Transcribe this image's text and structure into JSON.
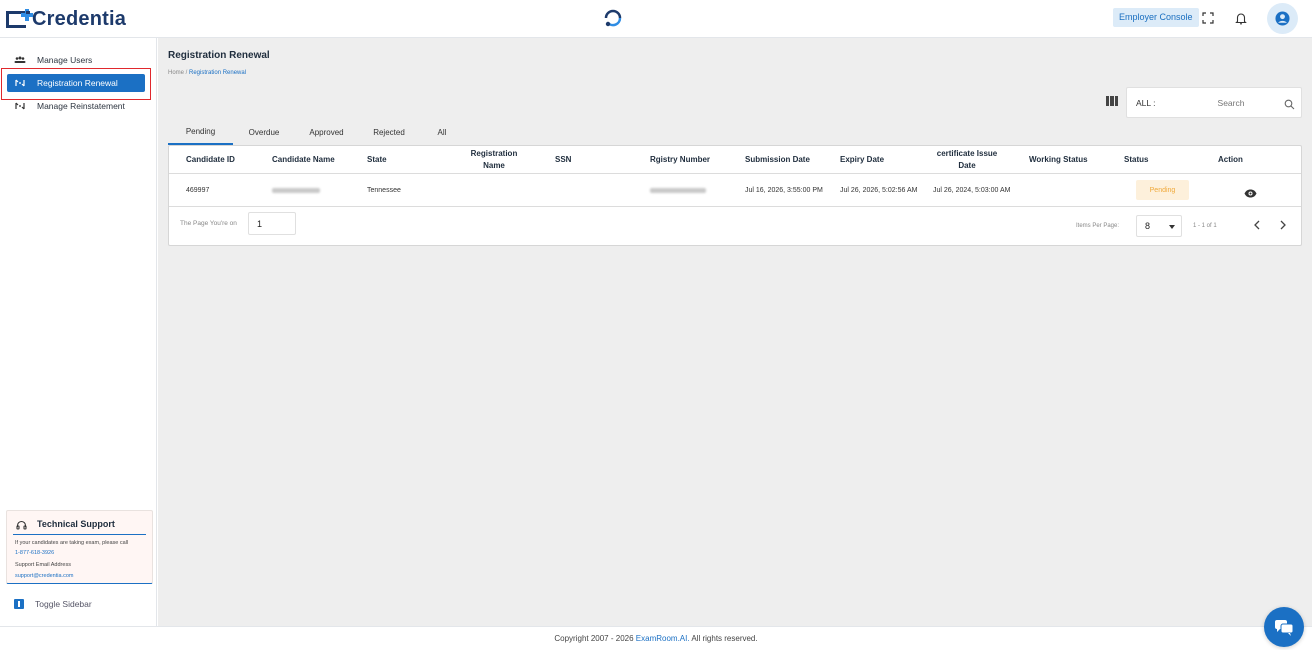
{
  "header": {
    "logo_text": "Credentia",
    "console_label": "Employer Console"
  },
  "sidebar": {
    "items": [
      {
        "label": "Manage Users",
        "icon": "users-icon"
      },
      {
        "label": "Registration Renewal",
        "icon": "renewal-icon",
        "active": true
      },
      {
        "label": "Manage Reinstatement",
        "icon": "reinstatement-icon"
      }
    ],
    "support": {
      "title": "Technical Support",
      "line1": "If your candidates are taking exam, please call",
      "phone": "1-877-618-3926",
      "line2": "Support Email Address",
      "email": "support@credentia.com"
    },
    "toggle_label": "Toggle Sidebar"
  },
  "main": {
    "title": "Registration Renewal",
    "breadcrumb": {
      "home": "Home /",
      "current": "Registration Renewal"
    },
    "search": {
      "scope": "ALL :",
      "placeholder": "Search"
    },
    "tabs": [
      "Pending",
      "Overdue",
      "Approved",
      "Rejected",
      "All"
    ],
    "table": {
      "columns": {
        "candidate_id": "Candidate ID",
        "candidate_name": "Candidate Name",
        "state": "State",
        "registration_name": "Registration Name",
        "ssn": "SSN",
        "registry_number": "Rgistry Number",
        "submission_date": "Submission Date",
        "expiry_date": "Expiry Date",
        "certificate_issue_date": "certificate Issue Date",
        "working_status": "Working Status",
        "status": "Status",
        "action": "Action"
      },
      "rows": [
        {
          "candidate_id": "469997",
          "state": "Tennessee",
          "registration_name": "",
          "ssn": "",
          "submission_date": "Jul 16, 2026, 3:55:00 PM",
          "expiry_date": "Jul 26, 2026, 5:02:56 AM",
          "certificate_issue_date": "Jul 26, 2024, 5:03:00 AM",
          "working_status": "",
          "status": "Pending"
        }
      ]
    },
    "pager": {
      "page_label": "The Page You're on",
      "page_value": "1",
      "items_per_page_label": "Items Per Page:",
      "items_per_page": "8",
      "range": "1 - 1 of 1"
    }
  },
  "footer": {
    "prefix": "Copyright 2007 - 2026",
    "brand": "ExamRoom.AI.",
    "suffix": "All rights reserved."
  },
  "colors": {
    "accent": "#1b70c4",
    "logo_navy": "#1d3a6b",
    "pending_bg": "#fdf0db",
    "pending_text": "#f0a93a"
  }
}
